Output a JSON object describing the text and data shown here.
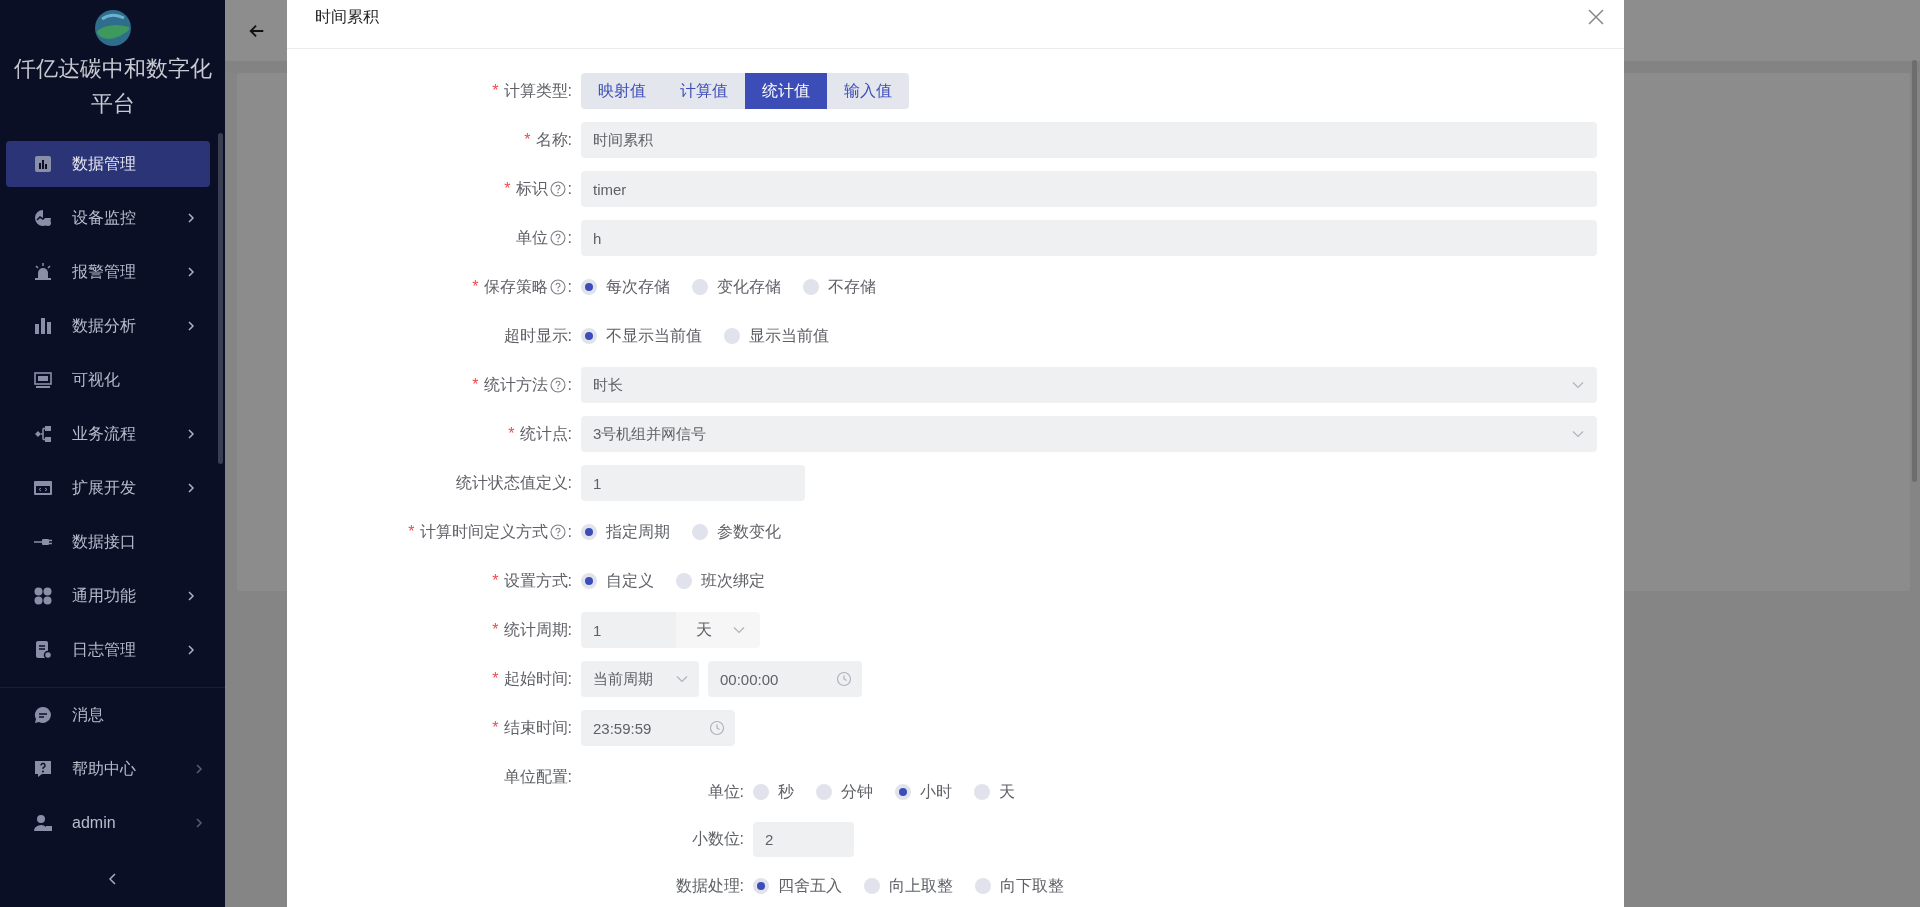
{
  "sidebar": {
    "title": "仟亿达碳中和数字化平台",
    "items": [
      {
        "label": "数据管理",
        "selected": true,
        "expandable": false
      },
      {
        "label": "设备监控",
        "selected": false,
        "expandable": true
      },
      {
        "label": "报警管理",
        "selected": false,
        "expandable": true
      },
      {
        "label": "数据分析",
        "selected": false,
        "expandable": true
      },
      {
        "label": "可视化",
        "selected": false,
        "expandable": false
      },
      {
        "label": "业务流程",
        "selected": false,
        "expandable": true
      },
      {
        "label": "扩展开发",
        "selected": false,
        "expandable": true
      },
      {
        "label": "数据接口",
        "selected": false,
        "expandable": false
      },
      {
        "label": "通用功能",
        "selected": false,
        "expandable": true
      },
      {
        "label": "日志管理",
        "selected": false,
        "expandable": true
      }
    ],
    "bottom_items": [
      {
        "label": "消息",
        "selected": false,
        "expandable": false
      },
      {
        "label": "帮助中心",
        "selected": false,
        "expandable": true
      },
      {
        "label": "admin",
        "selected": false,
        "expandable": true
      }
    ]
  },
  "dialog": {
    "title": "时间累积",
    "rows": [
      {
        "kind": "segmented",
        "mark": "*",
        "label": "计算类型:",
        "options": [
          {
            "label": "映射值",
            "selected": false
          },
          {
            "label": "计算值",
            "selected": false
          },
          {
            "label": "统计值",
            "selected": true
          },
          {
            "label": "输入值",
            "selected": false
          }
        ]
      },
      {
        "kind": "input",
        "mark": "*",
        "label": "名称:",
        "value": "时间累积"
      },
      {
        "kind": "input",
        "mark": "*",
        "label": "标识",
        "help": true,
        "colon": ":",
        "value": "timer"
      },
      {
        "kind": "input",
        "label": "单位",
        "help": true,
        "colon": ":",
        "value": "h"
      },
      {
        "kind": "radio",
        "mark": "*",
        "label": "保存策略",
        "help": true,
        "colon": ":",
        "options": [
          {
            "label": "每次存储",
            "selected": true
          },
          {
            "label": "变化存储",
            "selected": false
          },
          {
            "label": "不存储",
            "selected": false
          }
        ]
      },
      {
        "kind": "radio",
        "label": "超时显示:",
        "options": [
          {
            "label": "不显示当前值",
            "selected": true
          },
          {
            "label": "显示当前值",
            "selected": false
          }
        ]
      },
      {
        "kind": "select",
        "mark": "*",
        "label": "统计方法",
        "help": true,
        "colon": ":",
        "value": "时长"
      },
      {
        "kind": "select",
        "mark": "*",
        "label": "统计点:",
        "value": "3号机组并网信号"
      },
      {
        "kind": "input-short",
        "label": "统计状态值定义:",
        "value": "1"
      },
      {
        "kind": "radio",
        "mark": "*",
        "label": "计算时间定义方式",
        "help": true,
        "colon": ":",
        "options": [
          {
            "label": "指定周期",
            "selected": true
          },
          {
            "label": "参数变化",
            "selected": false
          }
        ]
      },
      {
        "kind": "radio",
        "mark": "*",
        "label": "设置方式:",
        "options": [
          {
            "label": "自定义",
            "selected": true
          },
          {
            "label": "班次绑定",
            "selected": false
          }
        ]
      },
      {
        "kind": "period",
        "mark": "*",
        "label": "统计周期:",
        "value": "1",
        "unit": "天"
      },
      {
        "kind": "start",
        "mark": "*",
        "label": "起始时间:",
        "value": "当前周期",
        "time": "00:00:00"
      },
      {
        "kind": "time",
        "mark": "*",
        "label": "结束时间:",
        "time": "23:59:59"
      },
      {
        "kind": "group",
        "label": "单位配置:",
        "children": [
          {
            "kind": "radio",
            "label": "单位:",
            "options": [
              {
                "label": "秒",
                "selected": false
              },
              {
                "label": "分钟",
                "selected": false
              },
              {
                "label": "小时",
                "selected": true
              },
              {
                "label": "天",
                "selected": false
              }
            ]
          },
          {
            "kind": "input-small",
            "label": "小数位:",
            "value": "2"
          },
          {
            "kind": "radio",
            "label": "数据处理:",
            "options": [
              {
                "label": "四舍五入",
                "selected": true
              },
              {
                "label": "向上取整",
                "selected": false
              },
              {
                "label": "向下取整",
                "selected": false
              }
            ]
          }
        ]
      }
    ]
  }
}
